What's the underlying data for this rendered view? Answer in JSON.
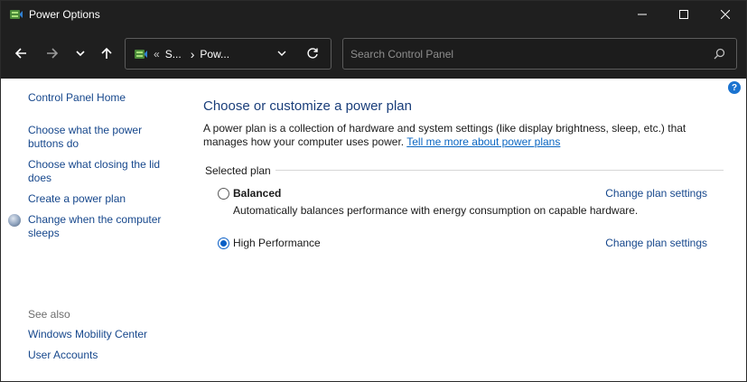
{
  "window": {
    "title": "Power Options",
    "app_icon": "power-options-icon",
    "controls": [
      "minimize-icon",
      "maximize-icon",
      "close-icon"
    ]
  },
  "nav": {
    "back_icon": "arrow-left-icon",
    "forward_icon": "arrow-right-icon",
    "recent_icon": "chevron-down-icon",
    "up_icon": "arrow-up-icon",
    "address": {
      "separator": "«",
      "crumbs": [
        "S...",
        "Pow..."
      ],
      "chevron": "›"
    },
    "search_placeholder": "Search Control Panel"
  },
  "sidebar": {
    "home": "Control Panel Home",
    "links": [
      "Choose what the power buttons do",
      "Choose what closing the lid does",
      "Create a power plan",
      "Change when the computer sleeps"
    ],
    "see_also_heading": "See also",
    "see_also": [
      "Windows Mobility Center",
      "User Accounts"
    ]
  },
  "main": {
    "help": "?",
    "title": "Choose or customize a power plan",
    "description": "A power plan is a collection of hardware and system settings (like display brightness, sleep, etc.) that manages how your computer uses power.",
    "learn_more": "Tell me more about power plans",
    "group_label": "Selected plan",
    "plans": [
      {
        "name": "Balanced",
        "description": "Automatically balances performance with energy consumption on capable hardware.",
        "selected": false,
        "change_label": "Change plan settings"
      },
      {
        "name": "High Performance",
        "description": "",
        "selected": true,
        "change_label": "Change plan settings"
      }
    ]
  },
  "colors": {
    "titlebar": "#1f1f1f",
    "link": "#16478c",
    "accent": "#0a5fc6",
    "heading": "#1a3e7a"
  }
}
